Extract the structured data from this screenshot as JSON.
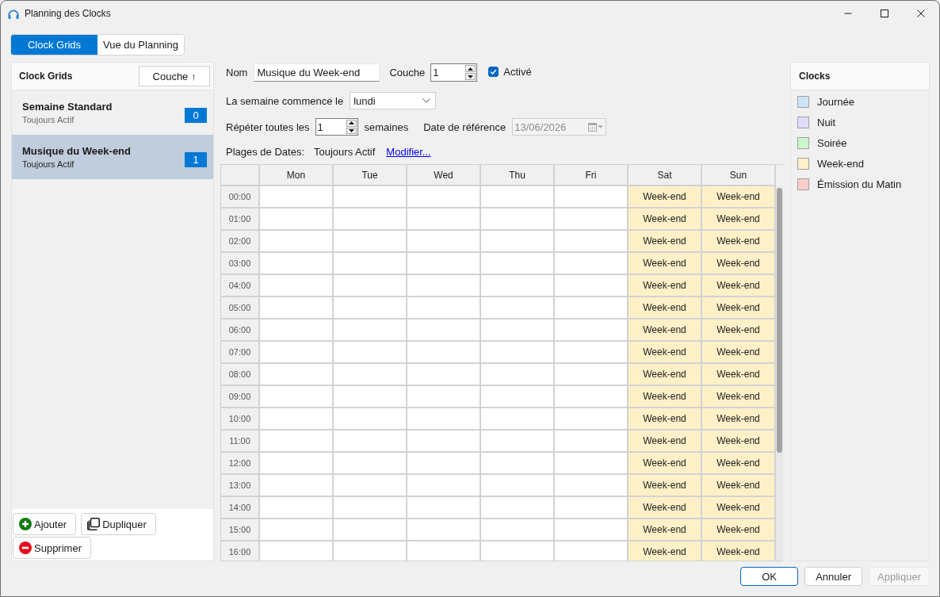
{
  "window": {
    "title": "Planning des Clocks"
  },
  "tabs": [
    {
      "label": "Clock Grids",
      "selected": true
    },
    {
      "label": "Vue du Planning",
      "selected": false
    }
  ],
  "clock_grids_panel": {
    "title": "Clock Grids",
    "sort_button": "Couche ↑",
    "items": [
      {
        "name": "Semaine Standard",
        "subtitle": "Toujours Actif",
        "layer": "0",
        "selected": false
      },
      {
        "name": "Musique du Week-end",
        "subtitle": "Toujours Actif",
        "layer": "1",
        "selected": true
      }
    ],
    "buttons": [
      {
        "label": "Ajouter",
        "kind": "add"
      },
      {
        "label": "Dupliquer",
        "kind": "duplicate"
      },
      {
        "label": "Supprimer",
        "kind": "delete"
      }
    ]
  },
  "form": {
    "name": {
      "label": "Nom",
      "value": "Musique du Week-end"
    },
    "layer": {
      "label": "Couche",
      "value": "1"
    },
    "enabled": {
      "label": "Activé",
      "checked": true
    },
    "week_start": {
      "label": "La semaine commence le",
      "value": "lundi"
    },
    "repeat": {
      "label": "Répéter toutes les",
      "value": "1",
      "unit": "semaines"
    },
    "reference_date": {
      "label": "Date de référence",
      "value": "13/06/2026",
      "disabled": true
    },
    "date_ranges": {
      "label": "Plages de Dates:",
      "value": "Toujours Actif",
      "link": "Modifier..."
    }
  },
  "grid": {
    "columns": [
      "Mon",
      "Tue",
      "Wed",
      "Thu",
      "Fri",
      "Sat",
      "Sun"
    ],
    "rows": [
      {
        "time": "00:00",
        "cells": [
          {
            "kind": "empty"
          },
          {
            "kind": "empty"
          },
          {
            "kind": "empty"
          },
          {
            "kind": "empty"
          },
          {
            "kind": "empty"
          },
          {
            "kind": "clock",
            "label": "Week-end",
            "color": "#fff0c8"
          },
          {
            "kind": "clock",
            "label": "Week-end",
            "color": "#fff0c8"
          }
        ]
      },
      {
        "time": "01:00",
        "cells": [
          {
            "kind": "empty"
          },
          {
            "kind": "empty"
          },
          {
            "kind": "empty"
          },
          {
            "kind": "empty"
          },
          {
            "kind": "empty"
          },
          {
            "kind": "clock",
            "label": "Week-end",
            "color": "#fff0c8"
          },
          {
            "kind": "clock",
            "label": "Week-end",
            "color": "#fff0c8"
          }
        ]
      },
      {
        "time": "02:00",
        "cells": [
          {
            "kind": "empty"
          },
          {
            "kind": "empty"
          },
          {
            "kind": "empty"
          },
          {
            "kind": "empty"
          },
          {
            "kind": "empty"
          },
          {
            "kind": "clock",
            "label": "Week-end",
            "color": "#fff0c8"
          },
          {
            "kind": "clock",
            "label": "Week-end",
            "color": "#fff0c8"
          }
        ]
      },
      {
        "time": "03:00",
        "cells": [
          {
            "kind": "empty"
          },
          {
            "kind": "empty"
          },
          {
            "kind": "empty"
          },
          {
            "kind": "empty"
          },
          {
            "kind": "empty"
          },
          {
            "kind": "clock",
            "label": "Week-end",
            "color": "#fff0c8"
          },
          {
            "kind": "clock",
            "label": "Week-end",
            "color": "#fff0c8"
          }
        ]
      },
      {
        "time": "04:00",
        "cells": [
          {
            "kind": "empty"
          },
          {
            "kind": "empty"
          },
          {
            "kind": "empty"
          },
          {
            "kind": "empty"
          },
          {
            "kind": "empty"
          },
          {
            "kind": "clock",
            "label": "Week-end",
            "color": "#fff0c8"
          },
          {
            "kind": "clock",
            "label": "Week-end",
            "color": "#fff0c8"
          }
        ]
      },
      {
        "time": "05:00",
        "cells": [
          {
            "kind": "empty"
          },
          {
            "kind": "empty"
          },
          {
            "kind": "empty"
          },
          {
            "kind": "empty"
          },
          {
            "kind": "empty"
          },
          {
            "kind": "clock",
            "label": "Week-end",
            "color": "#fff0c8"
          },
          {
            "kind": "clock",
            "label": "Week-end",
            "color": "#fff0c8"
          }
        ]
      },
      {
        "time": "06:00",
        "cells": [
          {
            "kind": "empty"
          },
          {
            "kind": "empty"
          },
          {
            "kind": "empty"
          },
          {
            "kind": "empty"
          },
          {
            "kind": "empty"
          },
          {
            "kind": "clock",
            "label": "Week-end",
            "color": "#fff0c8"
          },
          {
            "kind": "clock",
            "label": "Week-end",
            "color": "#fff0c8"
          }
        ]
      },
      {
        "time": "07:00",
        "cells": [
          {
            "kind": "empty"
          },
          {
            "kind": "empty"
          },
          {
            "kind": "empty"
          },
          {
            "kind": "empty"
          },
          {
            "kind": "empty"
          },
          {
            "kind": "clock",
            "label": "Week-end",
            "color": "#fff0c8"
          },
          {
            "kind": "clock",
            "label": "Week-end",
            "color": "#fff0c8"
          }
        ]
      },
      {
        "time": "08:00",
        "cells": [
          {
            "kind": "empty"
          },
          {
            "kind": "empty"
          },
          {
            "kind": "empty"
          },
          {
            "kind": "empty"
          },
          {
            "kind": "empty"
          },
          {
            "kind": "clock",
            "label": "Week-end",
            "color": "#fff0c8"
          },
          {
            "kind": "clock",
            "label": "Week-end",
            "color": "#fff0c8"
          }
        ]
      },
      {
        "time": "09:00",
        "cells": [
          {
            "kind": "empty"
          },
          {
            "kind": "empty"
          },
          {
            "kind": "empty"
          },
          {
            "kind": "empty"
          },
          {
            "kind": "empty"
          },
          {
            "kind": "clock",
            "label": "Week-end",
            "color": "#fff0c8"
          },
          {
            "kind": "clock",
            "label": "Week-end",
            "color": "#fff0c8"
          }
        ]
      },
      {
        "time": "10:00",
        "cells": [
          {
            "kind": "empty"
          },
          {
            "kind": "empty"
          },
          {
            "kind": "empty"
          },
          {
            "kind": "empty"
          },
          {
            "kind": "empty"
          },
          {
            "kind": "clock",
            "label": "Week-end",
            "color": "#fff0c8"
          },
          {
            "kind": "clock",
            "label": "Week-end",
            "color": "#fff0c8"
          }
        ]
      },
      {
        "time": "11:00",
        "cells": [
          {
            "kind": "empty"
          },
          {
            "kind": "empty"
          },
          {
            "kind": "empty"
          },
          {
            "kind": "empty"
          },
          {
            "kind": "empty"
          },
          {
            "kind": "clock",
            "label": "Week-end",
            "color": "#fff0c8"
          },
          {
            "kind": "clock",
            "label": "Week-end",
            "color": "#fff0c8"
          }
        ]
      },
      {
        "time": "12:00",
        "cells": [
          {
            "kind": "empty"
          },
          {
            "kind": "empty"
          },
          {
            "kind": "empty"
          },
          {
            "kind": "empty"
          },
          {
            "kind": "empty"
          },
          {
            "kind": "clock",
            "label": "Week-end",
            "color": "#fff0c8"
          },
          {
            "kind": "clock",
            "label": "Week-end",
            "color": "#fff0c8"
          }
        ]
      },
      {
        "time": "13:00",
        "cells": [
          {
            "kind": "empty"
          },
          {
            "kind": "empty"
          },
          {
            "kind": "empty"
          },
          {
            "kind": "empty"
          },
          {
            "kind": "empty"
          },
          {
            "kind": "clock",
            "label": "Week-end",
            "color": "#fff0c8"
          },
          {
            "kind": "clock",
            "label": "Week-end",
            "color": "#fff0c8"
          }
        ]
      },
      {
        "time": "14:00",
        "cells": [
          {
            "kind": "empty"
          },
          {
            "kind": "empty"
          },
          {
            "kind": "empty"
          },
          {
            "kind": "empty"
          },
          {
            "kind": "empty"
          },
          {
            "kind": "clock",
            "label": "Week-end",
            "color": "#fff0c8"
          },
          {
            "kind": "clock",
            "label": "Week-end",
            "color": "#fff0c8"
          }
        ]
      },
      {
        "time": "15:00",
        "cells": [
          {
            "kind": "empty"
          },
          {
            "kind": "empty"
          },
          {
            "kind": "empty"
          },
          {
            "kind": "empty"
          },
          {
            "kind": "empty"
          },
          {
            "kind": "clock",
            "label": "Week-end",
            "color": "#fff0c8"
          },
          {
            "kind": "clock",
            "label": "Week-end",
            "color": "#fff0c8"
          }
        ]
      },
      {
        "time": "16:00",
        "cells": [
          {
            "kind": "empty"
          },
          {
            "kind": "empty"
          },
          {
            "kind": "empty"
          },
          {
            "kind": "empty"
          },
          {
            "kind": "empty"
          },
          {
            "kind": "clock",
            "label": "Week-end",
            "color": "#fff0c8"
          },
          {
            "kind": "clock",
            "label": "Week-end",
            "color": "#fff0c8"
          }
        ]
      }
    ]
  },
  "clocks_panel": {
    "title": "Clocks",
    "items": [
      {
        "name": "Journée",
        "color": "#cce4f7"
      },
      {
        "name": "Nuit",
        "color": "#e2dcfa"
      },
      {
        "name": "Soirée",
        "color": "#ccf7cc"
      },
      {
        "name": "Week-end",
        "color": "#fff0c8"
      },
      {
        "name": "Émission du Matin",
        "color": "#ffcccc"
      }
    ]
  },
  "dialog_buttons": [
    {
      "label": "OK",
      "default": true,
      "disabled": false
    },
    {
      "label": "Annuler",
      "default": false,
      "disabled": false
    },
    {
      "label": "Appliquer",
      "default": false,
      "disabled": true
    }
  ]
}
